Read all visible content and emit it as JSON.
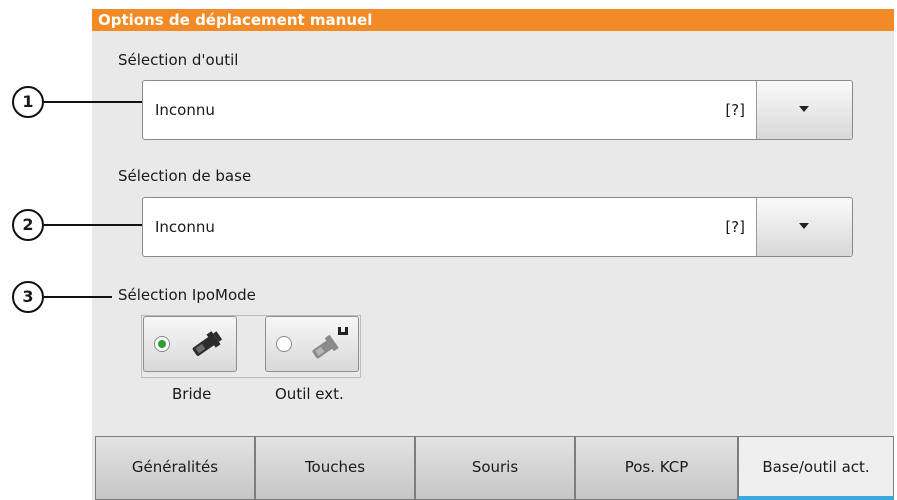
{
  "window": {
    "title": "Options de déplacement manuel",
    "accent_color": "#f28a25"
  },
  "tool_selection": {
    "label": "Sélection d'outil",
    "value": "Inconnu",
    "hint": "[?]",
    "callout": "1"
  },
  "base_selection": {
    "label": "Sélection de base",
    "value": "Inconnu",
    "hint": "[?]",
    "callout": "2"
  },
  "ipo_mode": {
    "label": "Sélection IpoMode",
    "callout": "3",
    "options": [
      {
        "label": "Bride",
        "icon": "flange-robot-icon",
        "selected": true
      },
      {
        "label": "Outil ext.",
        "icon": "external-tool-robot-icon",
        "selected": false
      }
    ]
  },
  "tabs": [
    {
      "label": "Généralités",
      "active": false
    },
    {
      "label": "Touches",
      "active": false
    },
    {
      "label": "Souris",
      "active": false
    },
    {
      "label": "Pos. KCP",
      "active": false
    },
    {
      "label": "Base/outil act.",
      "active": true
    }
  ],
  "colors": {
    "selected_radio": "#2e9e2e",
    "active_tab_underline": "#3ba8de"
  }
}
